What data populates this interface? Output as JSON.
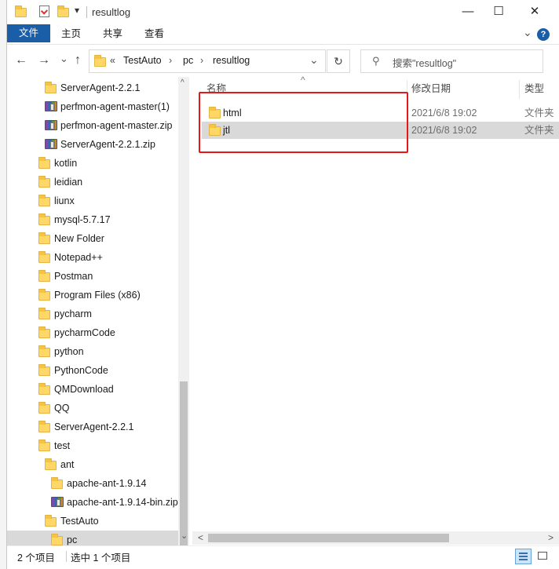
{
  "title_bar": {
    "title": "resultlog",
    "minimize_glyph": "—",
    "maximize_glyph": "☐",
    "close_glyph": "✕",
    "qat_dropdown_glyph": "▾"
  },
  "ribbon": {
    "file_tab": "文件",
    "tabs": [
      "主页",
      "共享",
      "查看"
    ],
    "collapse_glyph": "⌄",
    "help_glyph": "?"
  },
  "address_bar": {
    "back_glyph": "←",
    "forward_glyph": "→",
    "recent_glyph": "⌄",
    "up_glyph": "↑",
    "overflow_glyph": "«",
    "crumbs": [
      "TestAuto",
      "pc",
      "resultlog"
    ],
    "separator": "›",
    "dropdown_glyph": "⌄",
    "refresh_glyph": "↻"
  },
  "search": {
    "placeholder": "搜索\"resultlog\"",
    "icon_glyph": "⚲"
  },
  "nav_tree": {
    "items": [
      {
        "label": "ServerAgent-2.2.1",
        "icon": "folder-icon"
      },
      {
        "label": "perfmon-agent-master(1)",
        "icon": "zip-icon"
      },
      {
        "label": "perfmon-agent-master.zip",
        "icon": "zip-icon"
      },
      {
        "label": "ServerAgent-2.2.1.zip",
        "icon": "zip-icon"
      },
      {
        "label": "kotlin",
        "icon": "folder-icon"
      },
      {
        "label": "leidian",
        "icon": "folder-icon"
      },
      {
        "label": "liunx",
        "icon": "folder-icon"
      },
      {
        "label": "mysql-5.7.17",
        "icon": "folder-icon"
      },
      {
        "label": "New Folder",
        "icon": "folder-icon"
      },
      {
        "label": "Notepad++",
        "icon": "folder-icon"
      },
      {
        "label": "Postman",
        "icon": "folder-icon"
      },
      {
        "label": "Program Files (x86)",
        "icon": "folder-icon"
      },
      {
        "label": "pycharm",
        "icon": "folder-icon"
      },
      {
        "label": "pycharmCode",
        "icon": "folder-icon"
      },
      {
        "label": "python",
        "icon": "folder-icon"
      },
      {
        "label": "PythonCode",
        "icon": "folder-icon"
      },
      {
        "label": "QMDownload",
        "icon": "folder-icon"
      },
      {
        "label": "QQ",
        "icon": "folder-icon"
      },
      {
        "label": "ServerAgent-2.2.1",
        "icon": "folder-icon"
      },
      {
        "label": "test",
        "icon": "folder-icon"
      },
      {
        "label": "ant",
        "icon": "folder-icon"
      },
      {
        "label": "apache-ant-1.9.14",
        "icon": "folder-icon"
      },
      {
        "label": "apache-ant-1.9.14-bin.zip",
        "icon": "zip-icon"
      },
      {
        "label": "TestAuto",
        "icon": "folder-icon"
      },
      {
        "label": "pc",
        "icon": "folder-icon"
      }
    ]
  },
  "file_list": {
    "sort_glyph": "^",
    "columns": {
      "name": "名称",
      "date": "修改日期",
      "type": "类型"
    },
    "rows": [
      {
        "name": "html",
        "date": "2021/6/8 19:02",
        "type": "文件夹",
        "selected": false
      },
      {
        "name": "jtl",
        "date": "2021/6/8 19:02",
        "type": "文件夹",
        "selected": true
      }
    ]
  },
  "scroll": {
    "up_glyph": "^",
    "down_glyph": "⌄",
    "left_glyph": "<",
    "right_glyph": ">"
  },
  "status_bar": {
    "item_count": "2 个项目",
    "selection": "选中 1 个项目"
  },
  "colors": {
    "accent": "#1a5ea8",
    "selection": "#d9d9d9",
    "highlight_box": "#e31919",
    "folder": "#ffd766"
  }
}
